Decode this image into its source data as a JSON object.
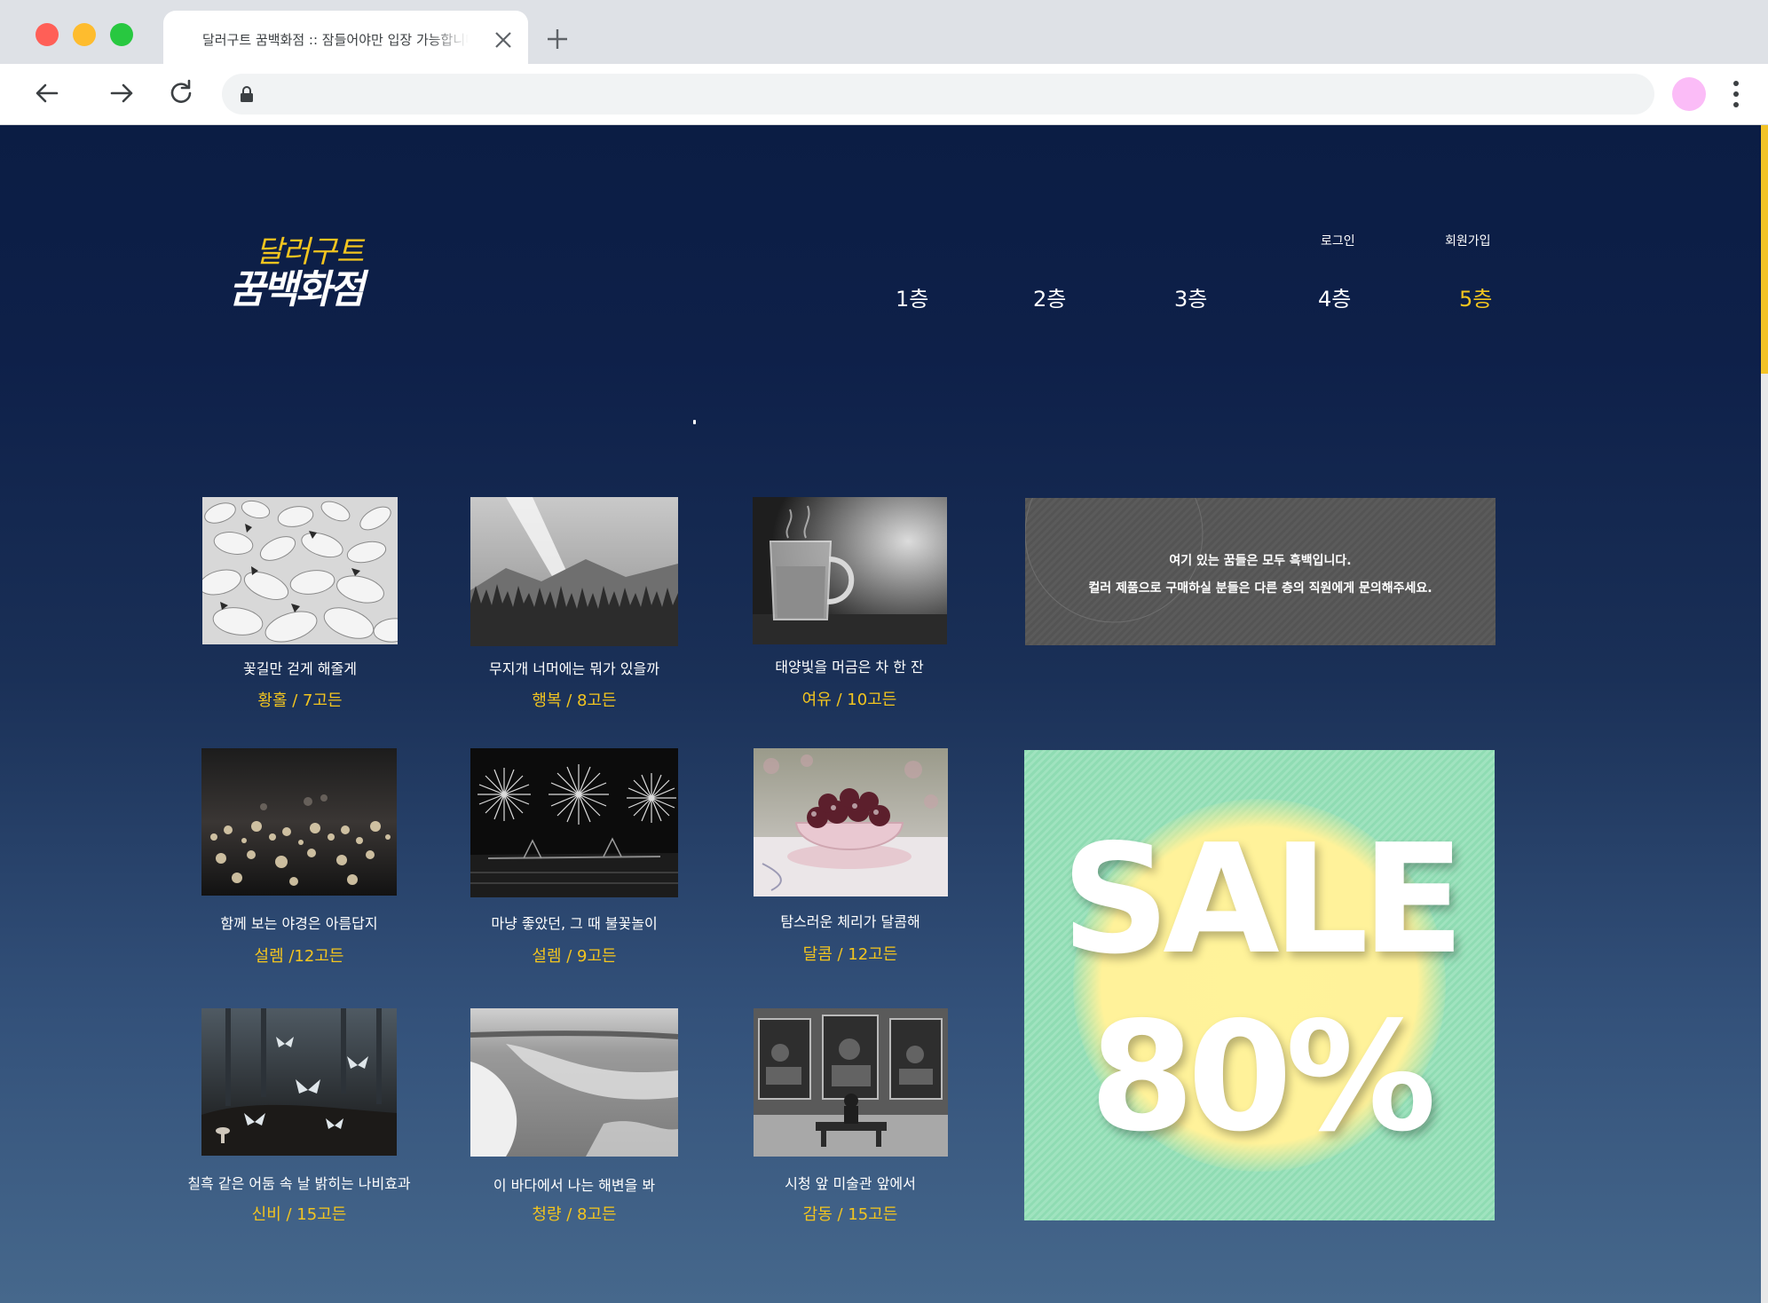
{
  "browser": {
    "tab_title": "달러구트 꿈백화점 :: 잠들어야만 입장 가능합니다",
    "url": "",
    "colors": {
      "close": "#ff5f57",
      "minimize": "#febc2e",
      "maximize": "#28c840",
      "avatar": "#fbbcf7"
    },
    "icons": [
      "back-arrow-icon",
      "forward-arrow-icon",
      "reload-icon",
      "lock-icon",
      "close-icon",
      "plus-icon",
      "kebab-menu-icon"
    ]
  },
  "site": {
    "logo": {
      "line1": "달러구트",
      "line2": "꿈백화점"
    },
    "util_links": {
      "login": "로그인",
      "signup": "회원가입"
    },
    "floors": [
      "1층",
      "2층",
      "3층",
      "4층",
      "5층"
    ],
    "active_floor": "5층",
    "accent_color": "#f3c51f",
    "notice": {
      "line1": "여기 있는 꿈들은 모두 흑백입니다.",
      "line2": "컬러 제품으로 구매하실 분들은 다른 층의 직원에게 문의해주세요."
    },
    "sale": {
      "text": "SALE",
      "percent": "80%"
    },
    "products": [
      {
        "name": "꽃길만 걷게 해줄게",
        "price": "황홀 / 7고든"
      },
      {
        "name": "무지개 너머에는 뭐가 있을까",
        "price": "행복 / 8고든"
      },
      {
        "name": "태양빛을 머금은 차 한 잔",
        "price": "여유 / 10고든"
      },
      {
        "name": "함께 보는 야경은 아름답지",
        "price": "설렘 /12고든"
      },
      {
        "name": "마냥 좋았던, 그 때 불꽃놀이",
        "price": "설렘 / 9고든"
      },
      {
        "name": "탐스러운 체리가 달콤해",
        "price": "달콤 / 12고든"
      },
      {
        "name": "칠흑 같은 어둠 속 날 밝히는 나비효과",
        "price": "신비 / 15고든"
      },
      {
        "name": "이 바다에서 나는 해변을 봐",
        "price": "청량 / 8고든"
      },
      {
        "name": "시청 앞 미술관 앞에서",
        "price": "감동 / 15고든"
      }
    ]
  }
}
